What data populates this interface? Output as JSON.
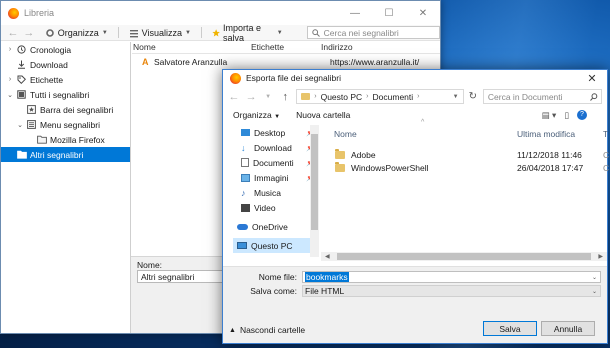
{
  "library": {
    "title": "Libreria",
    "toolbar": {
      "organize": "Organizza",
      "view": "Visualizza",
      "import_save": "Importa e salva",
      "search_placeholder": "Cerca nei segnalibri"
    },
    "tree": [
      {
        "label": "Cronologia",
        "icon": "clock-icon",
        "twisty": "›"
      },
      {
        "label": "Download",
        "icon": "download-icon",
        "twisty": ""
      },
      {
        "label": "Etichette",
        "icon": "tag-icon",
        "twisty": "›"
      },
      {
        "label": "Tutti i segnalibri",
        "icon": "bookmarks-icon",
        "twisty": "⌄"
      },
      {
        "label": "Barra dei segnalibri",
        "icon": "toolbar-icon",
        "twisty": ""
      },
      {
        "label": "Menu segnalibri",
        "icon": "menu-icon",
        "twisty": "⌄"
      },
      {
        "label": "Mozilla Firefox",
        "icon": "folder-icon",
        "twisty": ""
      },
      {
        "label": "Altri segnalibri",
        "icon": "folder-icon",
        "twisty": ""
      }
    ],
    "columns": {
      "name": "Nome",
      "tags": "Etichette",
      "address": "Indirizzo"
    },
    "row": {
      "name": "Salvatore Aranzulla",
      "address": "https://www.aranzulla.it/"
    },
    "details": {
      "name_label": "Nome:",
      "name_value": "Altri segnalibri"
    }
  },
  "dialog": {
    "title": "Esporta file dei segnalibri",
    "path": [
      "Questo PC",
      "Documenti"
    ],
    "search_placeholder": "Cerca in Documenti",
    "organize": "Organizza",
    "new_folder": "Nuova cartella",
    "nav": [
      {
        "label": "Desktop",
        "icon": "desktop-icon",
        "pinned": true
      },
      {
        "label": "Download",
        "icon": "download-icon",
        "pinned": true
      },
      {
        "label": "Documenti",
        "icon": "documents-icon",
        "pinned": true
      },
      {
        "label": "Immagini",
        "icon": "pictures-icon",
        "pinned": true
      },
      {
        "label": "Musica",
        "icon": "music-icon",
        "pinned": false
      },
      {
        "label": "Video",
        "icon": "video-icon",
        "pinned": false
      },
      {
        "label": "OneDrive",
        "icon": "cloud-icon",
        "pinned": false
      },
      {
        "label": "Questo PC",
        "icon": "computer-icon",
        "pinned": false
      }
    ],
    "columns": {
      "name": "Nome",
      "modified": "Ultima modifica",
      "more": "T"
    },
    "files": [
      {
        "name": "Adobe",
        "modified": "11/12/2018 11:46",
        "more": "C"
      },
      {
        "name": "WindowsPowerShell",
        "modified": "26/04/2018 17:47",
        "more": "C"
      }
    ],
    "file_name_label": "Nome file:",
    "file_name_value": "bookmarks",
    "save_as_label": "Salva come:",
    "save_as_value": "File HTML",
    "hide_folders": "Nascondi cartelle",
    "save_button": "Salva",
    "cancel_button": "Annulla"
  },
  "colors": {
    "selection": "#0078d7",
    "folder": "#e8c46a"
  }
}
